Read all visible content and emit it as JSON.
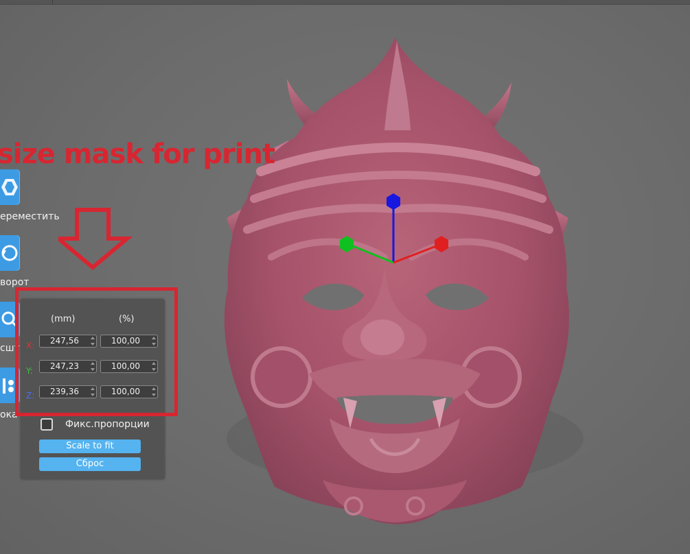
{
  "annotation": {
    "title": "size mask for print"
  },
  "toolbar": {
    "items": [
      {
        "label": "ереместить",
        "icon": "move-icon"
      },
      {
        "label": "ворот",
        "icon": "rotate-icon"
      },
      {
        "label": "сшт",
        "icon": "scale-icon"
      },
      {
        "label": "ока",
        "icon": "layout-icon"
      }
    ]
  },
  "scale_panel": {
    "col_mm": "(mm)",
    "col_percent": "(%)",
    "rows": [
      {
        "axis": "X:",
        "mm": "247,56",
        "percent": "100,00",
        "color": "#d63a3a"
      },
      {
        "axis": "Y:",
        "mm": "247,23",
        "percent": "100,00",
        "color": "#3cc43c"
      },
      {
        "axis": "Z:",
        "mm": "239,36",
        "percent": "100,00",
        "color": "#4c6cf0"
      }
    ],
    "lock_label": "Фикс.пропорции",
    "lock_checked": false,
    "scale_to_fit_label": "Scale to fit",
    "reset_label": "Сброс"
  },
  "colors": {
    "annotation_red": "#d72631",
    "button_blue": "#3d9be3",
    "model_color": "#a8546a"
  },
  "gizmo": {
    "x_color": "#e02020",
    "y_color": "#10c020",
    "z_color": "#1818e0"
  }
}
